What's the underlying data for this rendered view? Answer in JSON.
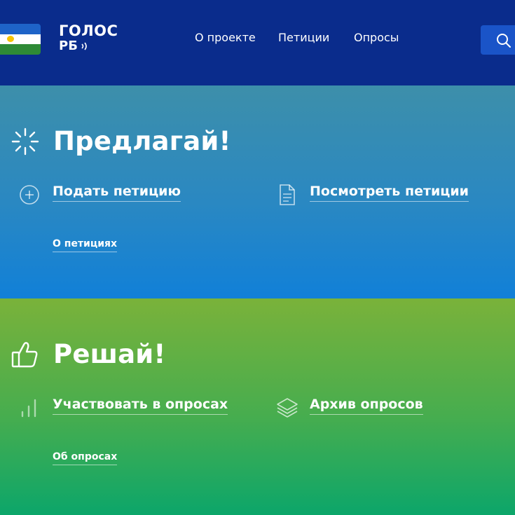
{
  "header": {
    "logo_top": "ГОЛОС",
    "logo_bottom": "РБ",
    "nav": [
      "О проекте",
      "Петиции",
      "Опросы"
    ],
    "flag_colors": [
      "#1e63c8",
      "#ffffff",
      "#2e8a36"
    ]
  },
  "propose": {
    "title": "Предлагай!",
    "icon": "sparkle-icon",
    "submit_label": "Подать петицию",
    "view_label": "Посмотреть петиции",
    "about_label": "О петициях"
  },
  "decide": {
    "title": "Решай!",
    "icon": "thumbs-up-icon",
    "participate_label": "Участвовать в опросах",
    "archive_label": "Архив опросов",
    "about_label": "Об опросах"
  },
  "colors": {
    "header_bg": "#0a2c8c",
    "blue_section": "#2a88c2",
    "green_section": "#46ad4f",
    "search_btn": "#1a54c8"
  }
}
